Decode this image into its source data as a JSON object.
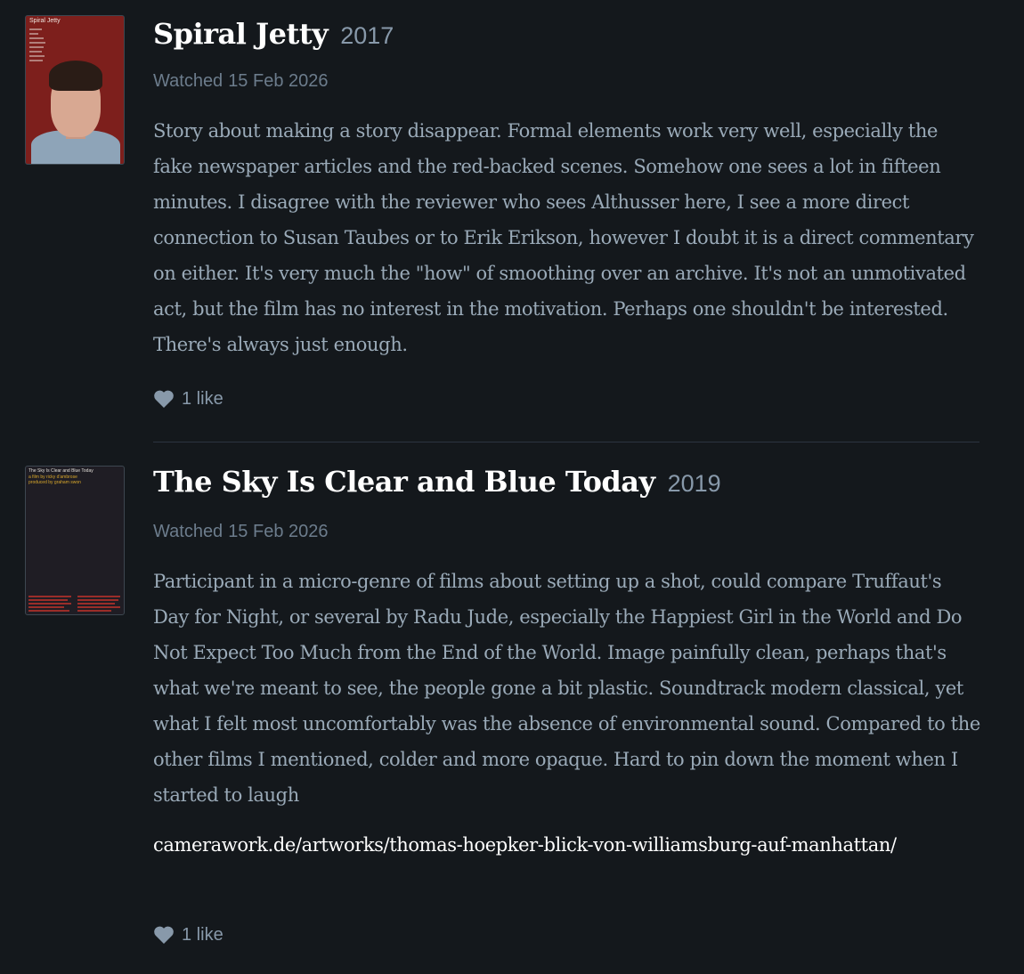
{
  "entries": [
    {
      "title": "Spiral Jetty",
      "year": "2017",
      "watched_label": "Watched",
      "watched_date": "15 Feb 2026",
      "poster_title": "Spiral Jetty",
      "review": "Story about making a story disappear. Formal elements work very well, especially the fake newspaper articles and the red-backed scenes. Somehow one sees a lot in fifteen minutes. I disagree with the reviewer who sees Althusser here, I see a more direct connection to Susan Taubes or to Erik Erikson, however I doubt it is a direct commentary on either. It's very much the \"how\" of smoothing over an archive. It's not an unmotivated act, but the film has no interest in the motivation. Perhaps one shouldn't be interested. There's always just enough.",
      "likes": "1 like"
    },
    {
      "title": "The Sky Is Clear and Blue Today",
      "year": "2019",
      "watched_label": "Watched",
      "watched_date": "15 Feb 2026",
      "poster_title": "The Sky Is Clear and Blue Today",
      "poster_line2": "a film by ricky d'ambrose",
      "poster_line3": "produced by graham swon",
      "review": "Participant in a micro-genre of films about setting up a shot, could compare Truffaut's Day for Night, or several by Radu Jude, especially the Happiest Girl in the World and Do Not Expect Too Much from the End of the World. Image painfully clean, perhaps that's what we're meant to see, the people gone a bit plastic. Soundtrack modern classical, yet what I felt most uncomfortably was the absence of environmental sound. Compared to the other films I mentioned, colder and more opaque. Hard to pin down the moment when I started to laugh",
      "link": "camerawork.de/artworks/thomas-hoepker-blick-von-williamsburg-auf-manhattan/",
      "likes": "1 like"
    }
  ],
  "icons": {
    "like": "heart-icon"
  },
  "colors": {
    "background": "#14181c",
    "title": "#ffffff",
    "meta": "#6c7c8c",
    "review_text": "#9aaab8",
    "link": "#ffffff"
  }
}
